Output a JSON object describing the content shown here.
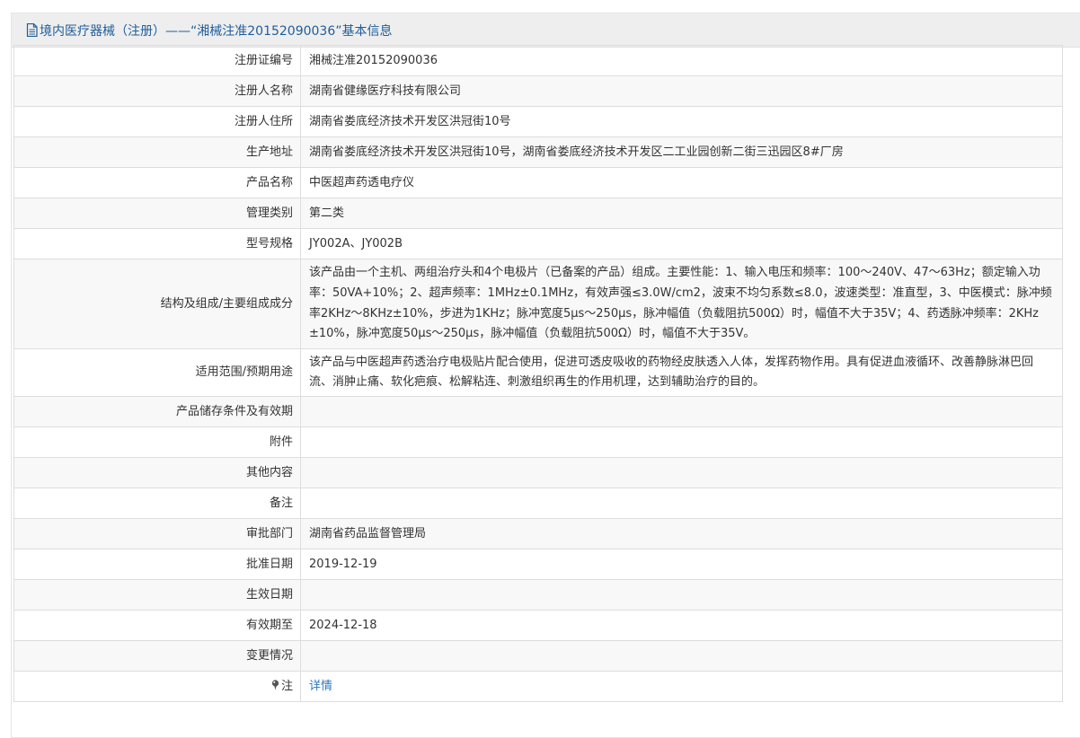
{
  "header": {
    "title": "境内医疗器械（注册）——“湘械注准20152090036”基本信息",
    "icon": "document-icon"
  },
  "rows": [
    {
      "label": "注册证编号",
      "value": "湘械注准20152090036"
    },
    {
      "label": "注册人名称",
      "value": "湖南省健缘医疗科技有限公司"
    },
    {
      "label": "注册人住所",
      "value": "湖南省娄底经济技术开发区洪冠街10号"
    },
    {
      "label": "生产地址",
      "value": "湖南省娄底经济技术开发区洪冠街10号，湖南省娄底经济技术开发区二工业园创新二街三迅园区8#厂房"
    },
    {
      "label": "产品名称",
      "value": "中医超声药透电疗仪"
    },
    {
      "label": "管理类别",
      "value": "第二类"
    },
    {
      "label": "型号规格",
      "value": "JY002A、JY002B"
    },
    {
      "label": "结构及组成/主要组成成分",
      "value": "该产品由一个主机、两组治疗头和4个电极片（已备案的产品）组成。主要性能：1、输入电压和频率：100～240V、47～63Hz；额定输入功率：50VA+10%；2、超声频率：1MHz±0.1MHz，有效声强≤3.0W/cm2，波束不均匀系数≤8.0，波速类型：准直型，3、中医模式：脉冲频率2KHz～8KHz±10%，步进为1KHz；脉冲宽度5μs～250μs，脉冲幅值（负载阻抗500Ω）时，幅值不大于35V；4、药透脉冲频率：2KHz±10%，脉冲宽度50μs～250μs，脉冲幅值（负载阻抗500Ω）时，幅值不大于35V。"
    },
    {
      "label": "适用范围/预期用途",
      "value": "该产品与中医超声药透治疗电极贴片配合使用，促进可透皮吸收的药物经皮肤透入人体，发挥药物作用。具有促进血液循环、改善静脉淋巴回流、消肿止痛、软化疤痕、松解粘连、刺激组织再生的作用机理，达到辅助治疗的目的。"
    },
    {
      "label": "产品储存条件及有效期",
      "value": ""
    },
    {
      "label": "附件",
      "value": ""
    },
    {
      "label": "其他内容",
      "value": ""
    },
    {
      "label": "备注",
      "value": ""
    },
    {
      "label": "审批部门",
      "value": "湖南省药品监督管理局"
    },
    {
      "label": "批准日期",
      "value": "2019-12-19"
    },
    {
      "label": "生效日期",
      "value": ""
    },
    {
      "label": "有效期至",
      "value": "2024-12-18"
    },
    {
      "label": "变更情况",
      "value": ""
    }
  ],
  "note_row": {
    "label": "注",
    "icon": "pin-icon",
    "link_text": "详情"
  },
  "colors": {
    "header_text": "#1f5d9b",
    "header_bg": "#eeeeee",
    "link": "#2b78c2",
    "border": "#dddddd",
    "stripe": "#f8f8f8"
  }
}
